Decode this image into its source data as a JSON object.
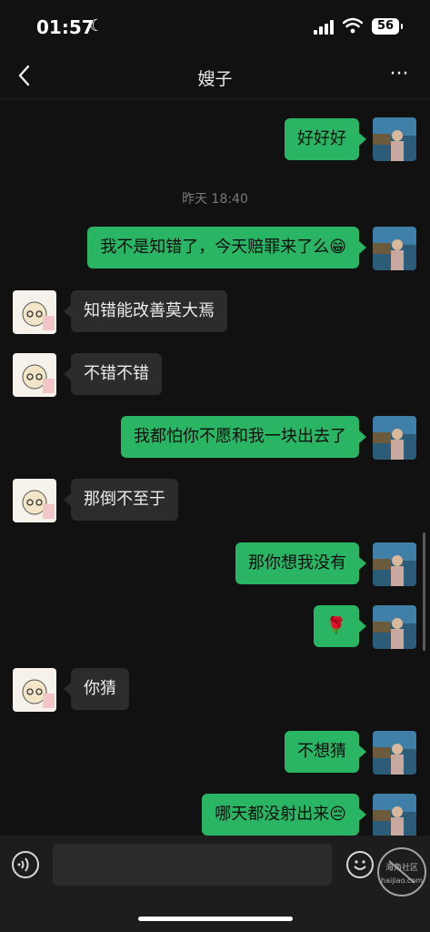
{
  "status_bar": {
    "time": "01:57",
    "battery": "56"
  },
  "header": {
    "title": "嫂子",
    "more": "···"
  },
  "messages": [
    {
      "side": "me",
      "text": "好好好"
    },
    {
      "side": "timestamp",
      "text": "昨天 18:40"
    },
    {
      "side": "me",
      "text": "我不是知错了，今天赔罪来了么😁"
    },
    {
      "side": "them",
      "text": "知错能改善莫大焉"
    },
    {
      "side": "them",
      "text": "不错不错"
    },
    {
      "side": "me",
      "text": "我都怕你不愿和我一块出去了"
    },
    {
      "side": "them",
      "text": "那倒不至于"
    },
    {
      "side": "me",
      "text": "那你想我没有"
    },
    {
      "side": "me",
      "text": "🌹"
    },
    {
      "side": "them",
      "text": "你猜"
    },
    {
      "side": "me",
      "text": "不想猜"
    },
    {
      "side": "me",
      "text": "哪天都没射出来😔"
    }
  ],
  "input_bar": {
    "watermark_text": "海角社区 haijiao.com"
  },
  "colors": {
    "me_bubble": "#29b563",
    "them_bubble": "#2c2c2c",
    "background": "#111111"
  },
  "icons": {
    "back": "chevron-left-icon",
    "more": "more-dots-icon",
    "voice": "voice-icon",
    "emoji": "emoji-icon"
  }
}
